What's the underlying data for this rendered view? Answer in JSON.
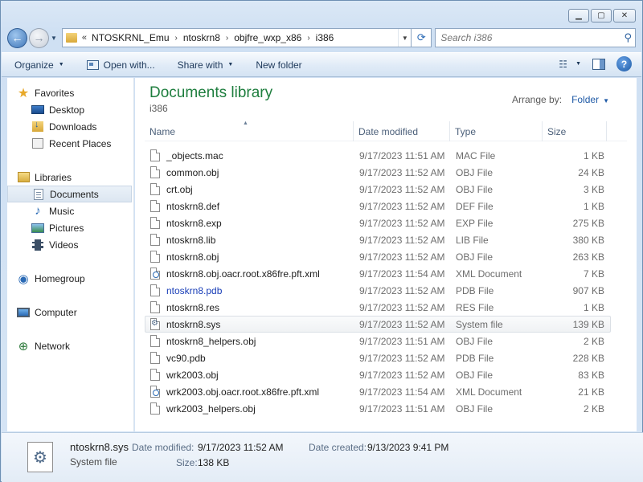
{
  "window": {
    "caption_minimize": "▁",
    "caption_maximize": "▢",
    "caption_close": "✕"
  },
  "address": {
    "chevron": "«",
    "crumbs": [
      "NTOSKRNL_Emu",
      "ntoskrn8",
      "objfre_wxp_x86",
      "i386"
    ],
    "separator": "›"
  },
  "search": {
    "placeholder": "Search i386"
  },
  "toolbar": {
    "organize": "Organize",
    "open_with": "Open with...",
    "share_with": "Share with",
    "new_folder": "New folder"
  },
  "sidebar": {
    "favorites": "Favorites",
    "desktop": "Desktop",
    "downloads": "Downloads",
    "recent_places": "Recent Places",
    "libraries": "Libraries",
    "documents": "Documents",
    "music": "Music",
    "pictures": "Pictures",
    "videos": "Videos",
    "homegroup": "Homegroup",
    "computer": "Computer",
    "network": "Network"
  },
  "library": {
    "title": "Documents library",
    "subtitle": "i386",
    "arrange_label": "Arrange by:",
    "arrange_value": "Folder"
  },
  "columns": {
    "name": "Name",
    "date": "Date modified",
    "type": "Type",
    "size": "Size"
  },
  "files": [
    {
      "name": "_objects.mac",
      "date": "9/17/2023 11:51 AM",
      "type": "MAC File",
      "size": "1 KB",
      "icon": "file"
    },
    {
      "name": "common.obj",
      "date": "9/17/2023 11:52 AM",
      "type": "OBJ File",
      "size": "24 KB",
      "icon": "file"
    },
    {
      "name": "crt.obj",
      "date": "9/17/2023 11:52 AM",
      "type": "OBJ File",
      "size": "3 KB",
      "icon": "file"
    },
    {
      "name": "ntoskrn8.def",
      "date": "9/17/2023 11:52 AM",
      "type": "DEF File",
      "size": "1 KB",
      "icon": "file"
    },
    {
      "name": "ntoskrn8.exp",
      "date": "9/17/2023 11:52 AM",
      "type": "EXP File",
      "size": "275 KB",
      "icon": "file"
    },
    {
      "name": "ntoskrn8.lib",
      "date": "9/17/2023 11:52 AM",
      "type": "LIB File",
      "size": "380 KB",
      "icon": "file"
    },
    {
      "name": "ntoskrn8.obj",
      "date": "9/17/2023 11:52 AM",
      "type": "OBJ File",
      "size": "263 KB",
      "icon": "file"
    },
    {
      "name": "ntoskrn8.obj.oacr.root.x86fre.pft.xml",
      "date": "9/17/2023 11:54 AM",
      "type": "XML Document",
      "size": "7 KB",
      "icon": "xml"
    },
    {
      "name": "ntoskrn8.pdb",
      "date": "9/17/2023 11:52 AM",
      "type": "PDB File",
      "size": "907 KB",
      "icon": "file",
      "name_color": "#1a3fb8"
    },
    {
      "name": "ntoskrn8.res",
      "date": "9/17/2023 11:52 AM",
      "type": "RES File",
      "size": "1 KB",
      "icon": "file"
    },
    {
      "name": "ntoskrn8.sys",
      "date": "9/17/2023 11:52 AM",
      "type": "System file",
      "size": "139 KB",
      "icon": "sys",
      "hovered": true
    },
    {
      "name": "ntoskrn8_helpers.obj",
      "date": "9/17/2023 11:51 AM",
      "type": "OBJ File",
      "size": "2 KB",
      "icon": "file"
    },
    {
      "name": "vc90.pdb",
      "date": "9/17/2023 11:52 AM",
      "type": "PDB File",
      "size": "228 KB",
      "icon": "file"
    },
    {
      "name": "wrk2003.obj",
      "date": "9/17/2023 11:52 AM",
      "type": "OBJ File",
      "size": "83 KB",
      "icon": "file"
    },
    {
      "name": "wrk2003.obj.oacr.root.x86fre.pft.xml",
      "date": "9/17/2023 11:54 AM",
      "type": "XML Document",
      "size": "21 KB",
      "icon": "xml"
    },
    {
      "name": "wrk2003_helpers.obj",
      "date": "9/17/2023 11:51 AM",
      "type": "OBJ File",
      "size": "2 KB",
      "icon": "file"
    }
  ],
  "details": {
    "name": "ntoskrn8.sys",
    "type": "System file",
    "date_modified_label": "Date modified:",
    "date_modified": "9/17/2023 11:52 AM",
    "date_created_label": "Date created:",
    "date_created": "9/13/2023 9:41 PM",
    "size_label": "Size:",
    "size": "138 KB"
  },
  "colors": {
    "library_title": "#1e7e3e",
    "link_blue": "#1f5aa6",
    "hover_row_border": "#dadfe5"
  }
}
